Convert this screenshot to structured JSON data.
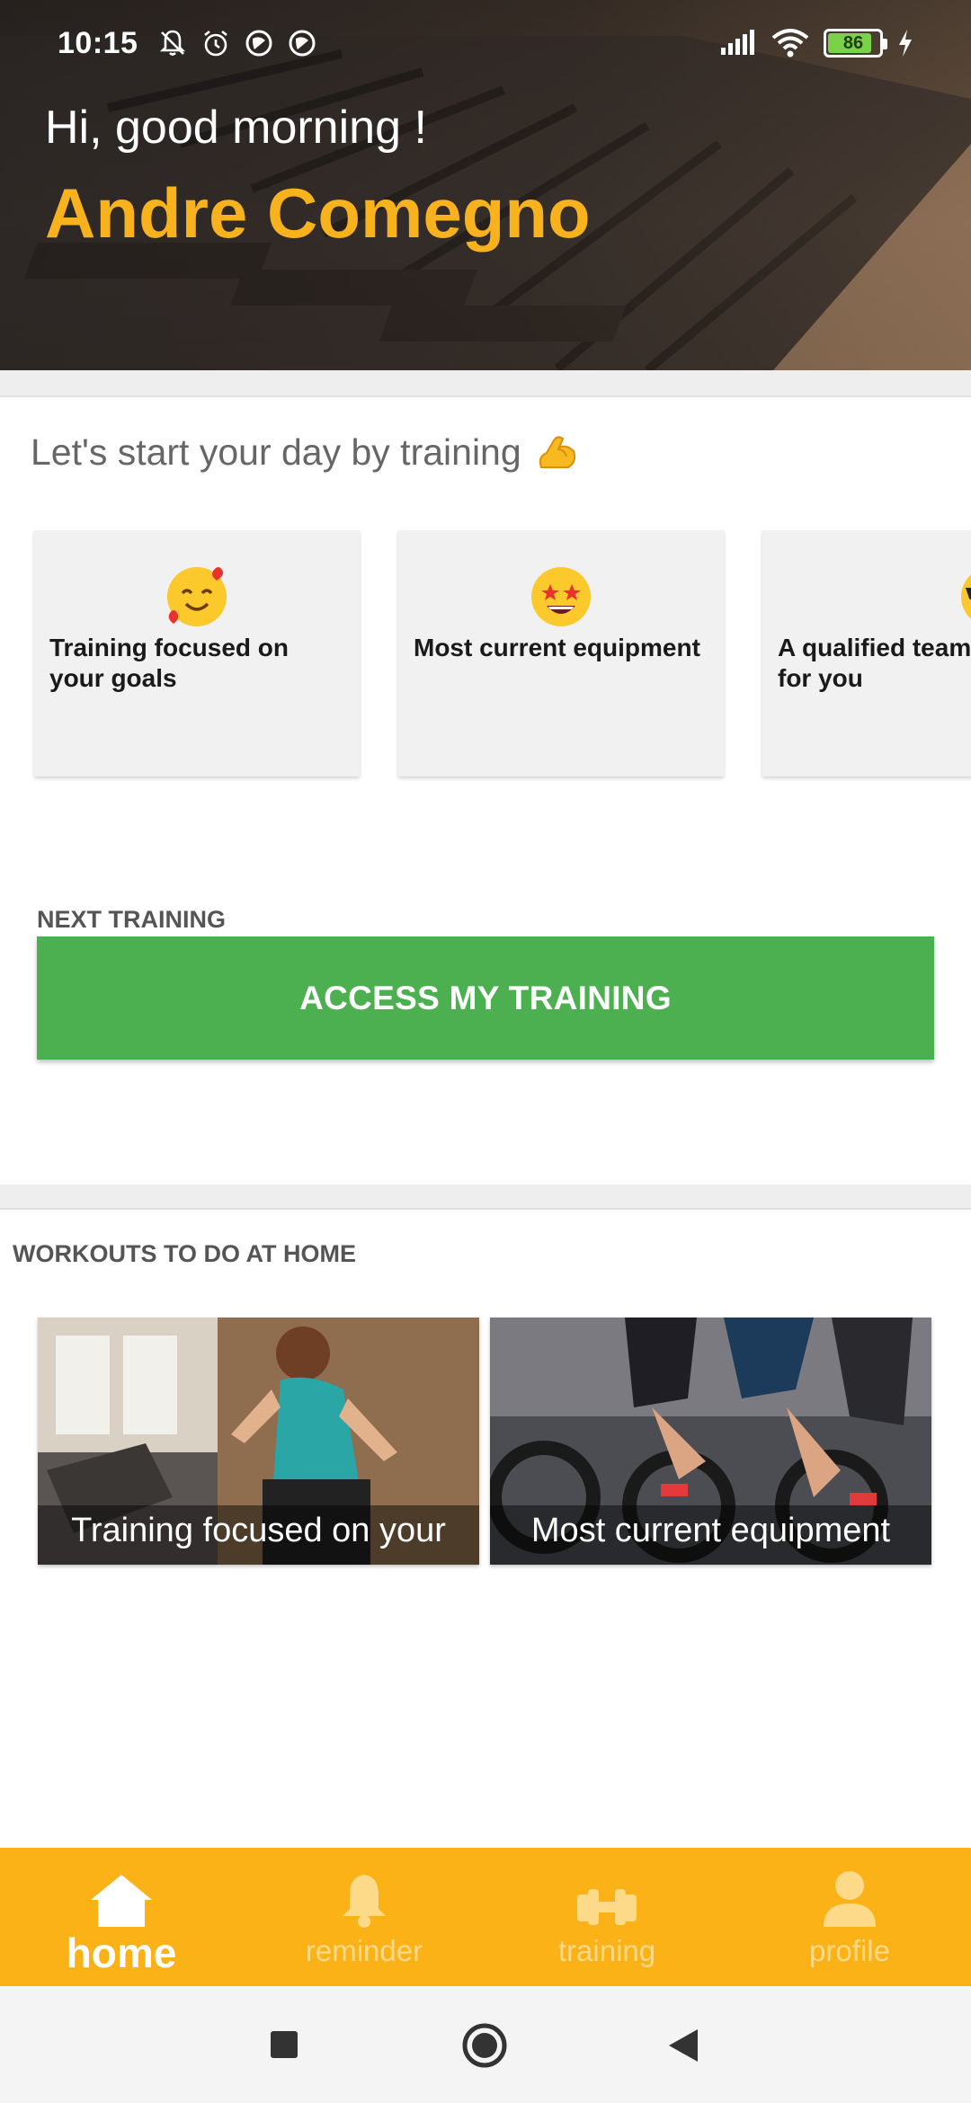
{
  "status_bar": {
    "time": "10:15",
    "icons_left": [
      "bell-off-icon",
      "alarm-icon",
      "no-disturb-icon",
      "no-disturb-icon"
    ],
    "icons_right": [
      "signal-icon",
      "wifi-icon",
      "battery-icon",
      "charging-icon"
    ],
    "battery_level": "86",
    "battery_fraction": 0.86
  },
  "header": {
    "greeting": "Hi, good morning !",
    "user_name": "Andre Comegno"
  },
  "intro": {
    "text": "Let's start your day by training",
    "emoji": "flexed-biceps-emoji"
  },
  "feature_cards": [
    {
      "emoji": "smiling-face-with-hearts-emoji",
      "text": "Training focused on your goals"
    },
    {
      "emoji": "star-struck-emoji",
      "text": "Most current equipment"
    },
    {
      "emoji": "smiling-face-with-sunglasses-emoji",
      "text": "A qualified team for you"
    }
  ],
  "next_training": {
    "label": "NEXT TRAINING",
    "button_label": "ACCESS MY TRAINING"
  },
  "workouts": {
    "label": "WORKOUTS TO DO AT HOME",
    "items": [
      {
        "caption": "Training focused on your goals",
        "image": "woman-running-treadmill-photo"
      },
      {
        "caption": "Most current equipment",
        "image": "spinning-bikes-class-photo"
      }
    ]
  },
  "bottom_nav": {
    "items": [
      {
        "label": "home",
        "icon": "home-icon",
        "active": true
      },
      {
        "label": "reminder",
        "icon": "bell-icon",
        "active": false
      },
      {
        "label": "training",
        "icon": "dumbbell-icon",
        "active": false
      },
      {
        "label": "profile",
        "icon": "person-icon",
        "active": false
      }
    ]
  },
  "system_nav": [
    "recents-icon",
    "home-circle-icon",
    "back-icon"
  ],
  "colors": {
    "accent": "#fbb217",
    "name": "#f7b21e",
    "button": "#4caf50"
  }
}
